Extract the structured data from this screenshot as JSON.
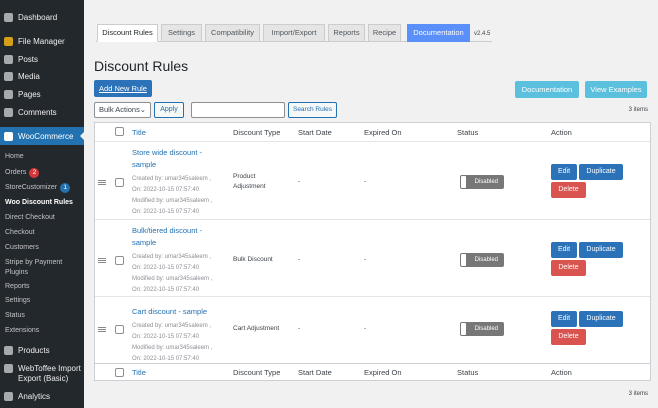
{
  "sidebar": {
    "items": [
      "Dashboard",
      "File Manager",
      "Posts",
      "Media",
      "Pages",
      "Comments"
    ],
    "woocommerce": "WooCommerce",
    "sub": [
      "Home",
      "Orders",
      "StoreCustomizer",
      "Woo Discount Rules",
      "Direct Checkout",
      "Checkout",
      "Customers",
      "Stripe by Payment Plugins",
      "Reports",
      "Settings",
      "Status",
      "Extensions"
    ],
    "orders_badge": "2",
    "sc_badge": "1",
    "bottom": [
      "Products",
      "WebToffee Import Export (Basic)",
      "Analytics"
    ]
  },
  "tabs": [
    "Discount Rules",
    "Settings",
    "Compatibility",
    "Import/Export",
    "Reports",
    "Recipe",
    "Documentation"
  ],
  "version": "v2.4.5",
  "page_title": "Discount Rules",
  "add_new": "Add New Rule",
  "documentation_btn": "Documentation",
  "view_examples": "View Examples",
  "bulk_actions": "Bulk Actions",
  "apply": "Apply",
  "search_value": "",
  "search_btn": "Search Rules",
  "items_count": "3 items",
  "columns": [
    "Title",
    "Discount Type",
    "Start Date",
    "Expired On",
    "Status",
    "Action"
  ],
  "rows": [
    {
      "title": "Store wide discount - sample",
      "created": "Created by: umar345saleem ,",
      "created_on": "On: 2022-10-15 07:57:40",
      "modified": "Modified by: umar345saleem ,",
      "modified_on": "On: 2022-10-15 07:57:40",
      "type": "Product Adjustment",
      "start": "-",
      "end": "-",
      "status": "Disabled"
    },
    {
      "title": "Bulk/tiered discount - sample",
      "created": "Created by: umar345saleem ,",
      "created_on": "On: 2022-10-15 07:57:40",
      "modified": "Modified by: umar345saleem ,",
      "modified_on": "On: 2022-10-15 07:57:40",
      "type": "Bulk Discount",
      "start": "-",
      "end": "-",
      "status": "Disabled"
    },
    {
      "title": "Cart discount - sample",
      "created": "Created by: umar345saleem ,",
      "created_on": "On: 2022-10-15 07:57:40",
      "modified": "Modified by: umar345saleem ,",
      "modified_on": "On: 2022-10-15 07:57:40",
      "type": "Cart Adjustment",
      "start": "-",
      "end": "-",
      "status": "Disabled"
    }
  ],
  "actions": {
    "edit": "Edit",
    "duplicate": "Duplicate",
    "delete": "Delete"
  }
}
